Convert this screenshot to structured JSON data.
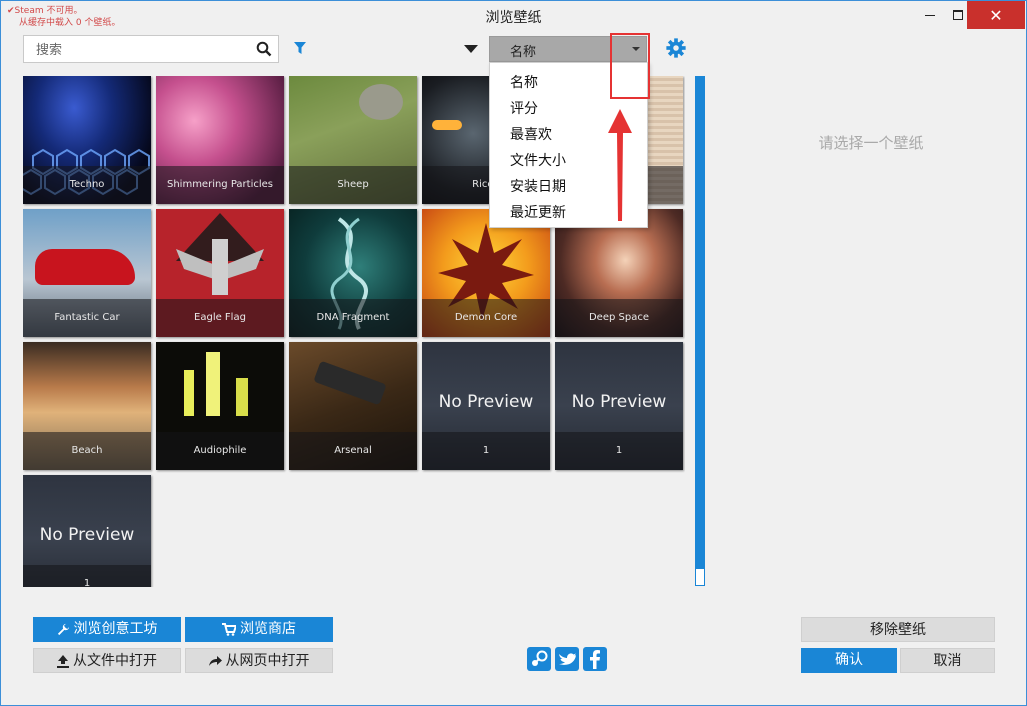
{
  "window": {
    "title": "浏览壁纸",
    "steam_warning_line1": "Steam 不可用。",
    "steam_warning_line2": "从缓存中载入 0 个壁纸。",
    "close_label": "✕"
  },
  "toolbar": {
    "search_placeholder": "搜索",
    "sort_value": "名称"
  },
  "sort_options": [
    "名称",
    "评分",
    "最喜欢",
    "文件大小",
    "安装日期",
    "最近更新"
  ],
  "wallpapers": [
    {
      "name": "Techno"
    },
    {
      "name": "Shimmering Particles"
    },
    {
      "name": "Sheep"
    },
    {
      "name": "Ricep"
    },
    {
      "name": ""
    },
    {
      "name": "Fantastic Car"
    },
    {
      "name": "Eagle Flag"
    },
    {
      "name": "DNA Fragment"
    },
    {
      "name": "Demon Core"
    },
    {
      "name": "Deep Space"
    },
    {
      "name": "Beach"
    },
    {
      "name": "Audiophile"
    },
    {
      "name": "Arsenal"
    },
    {
      "name": "1",
      "preview": "No Preview"
    },
    {
      "name": "1",
      "preview": "No Preview"
    },
    {
      "name": "1",
      "preview": "No Preview"
    }
  ],
  "preview_panel": {
    "empty_message": "请选择一个壁纸"
  },
  "buttons": {
    "workshop": "浏览创意工坊",
    "store": "浏览商店",
    "open_file": "从文件中打开",
    "open_web": "从网页中打开",
    "remove": "移除壁纸",
    "ok": "确认",
    "cancel": "取消"
  },
  "colors": {
    "accent": "#1a86d6",
    "close": "#c9302c",
    "annotation": "#e53333"
  }
}
